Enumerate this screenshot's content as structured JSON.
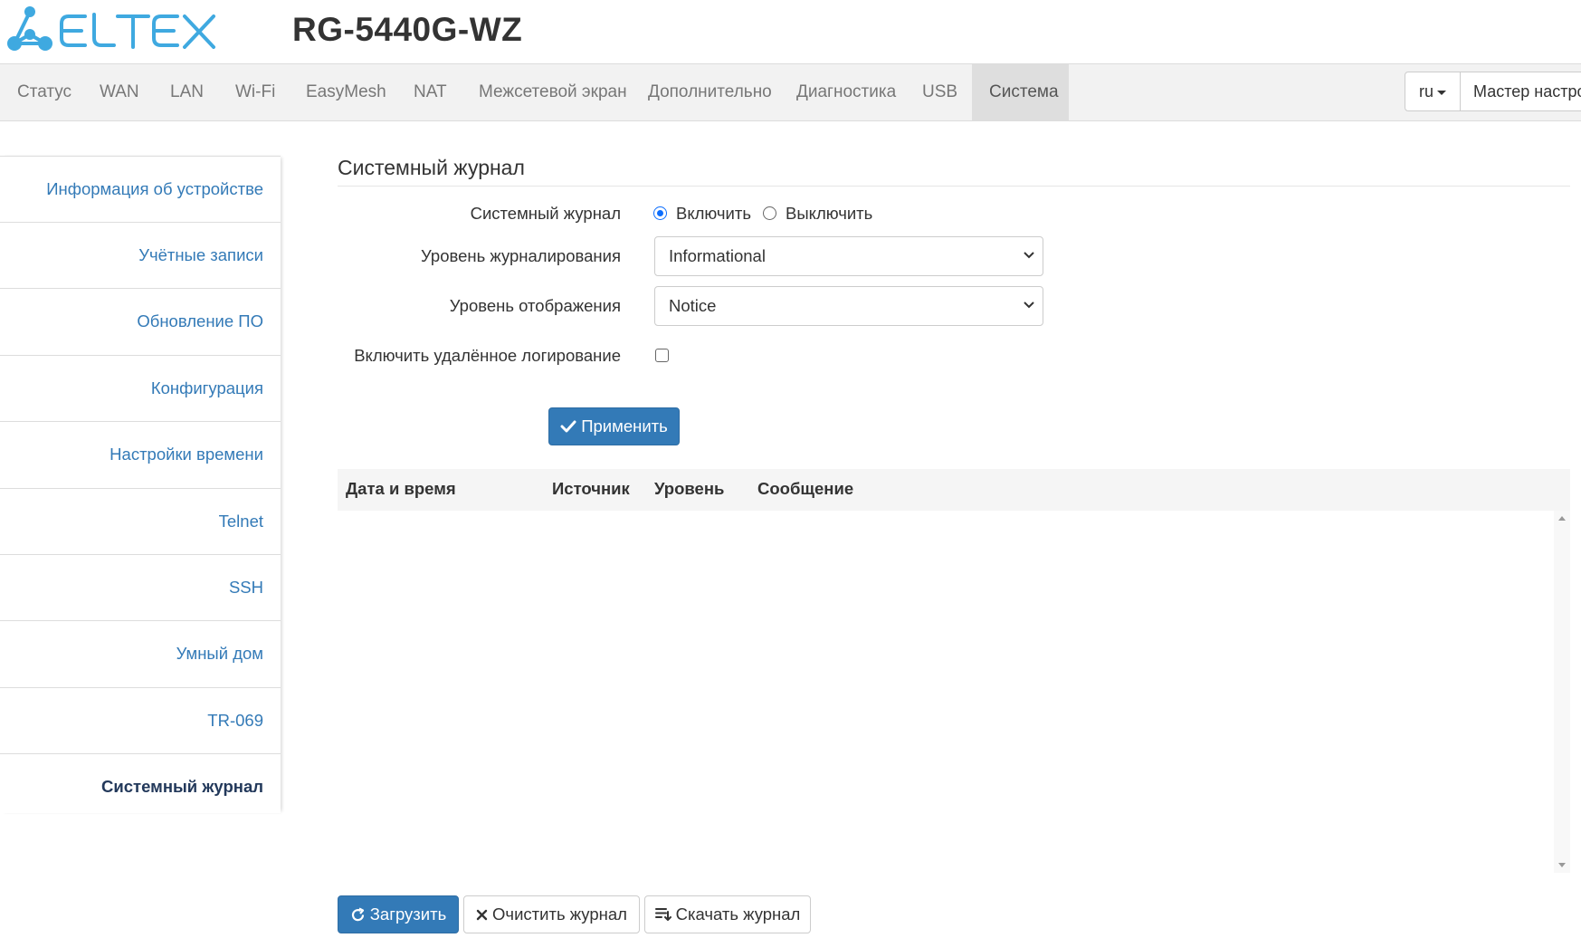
{
  "header": {
    "logo_text": "ELTEX",
    "device_model": "RG-5440G-WZ"
  },
  "nav": {
    "items": [
      "Статус",
      "WAN",
      "LAN",
      "Wi-Fi",
      "EasyMesh",
      "NAT",
      "Межсетевой экран",
      "Дополнительно",
      "Диагностика",
      "USB",
      "Система"
    ],
    "active": "Система",
    "language": "ru",
    "wizard_label": "Мастер настро"
  },
  "sidebar": {
    "items": [
      "Информация об устройстве",
      "Учётные записи",
      "Обновление ПО",
      "Конфигурация",
      "Настройки времени",
      "Telnet",
      "SSH",
      "Умный дом",
      "TR-069",
      "Системный журнал"
    ],
    "active": "Системный журнал"
  },
  "syslog": {
    "title": "Системный журнал",
    "enable_label": "Системный журнал",
    "on_label": "Включить",
    "off_label": "Выключить",
    "enabled": true,
    "log_level_label": "Уровень журналирования",
    "log_level_value": "Informational",
    "display_level_label": "Уровень отображения",
    "display_level_value": "Notice",
    "remote_label": "Включить удалённое логирование",
    "remote_enabled": false,
    "apply_label": "Применить"
  },
  "table": {
    "columns": [
      "Дата и время",
      "Источник",
      "Уровень",
      "Сообщение"
    ],
    "rows": []
  },
  "actions": {
    "load_label": "Загрузить",
    "clear_label": "Очистить журнал",
    "download_label": "Скачать журнал"
  },
  "colors": {
    "brand": "#3fa9e0",
    "primary": "#337ab7",
    "link": "#337ab7",
    "radio_checked": "#0d6efd"
  }
}
